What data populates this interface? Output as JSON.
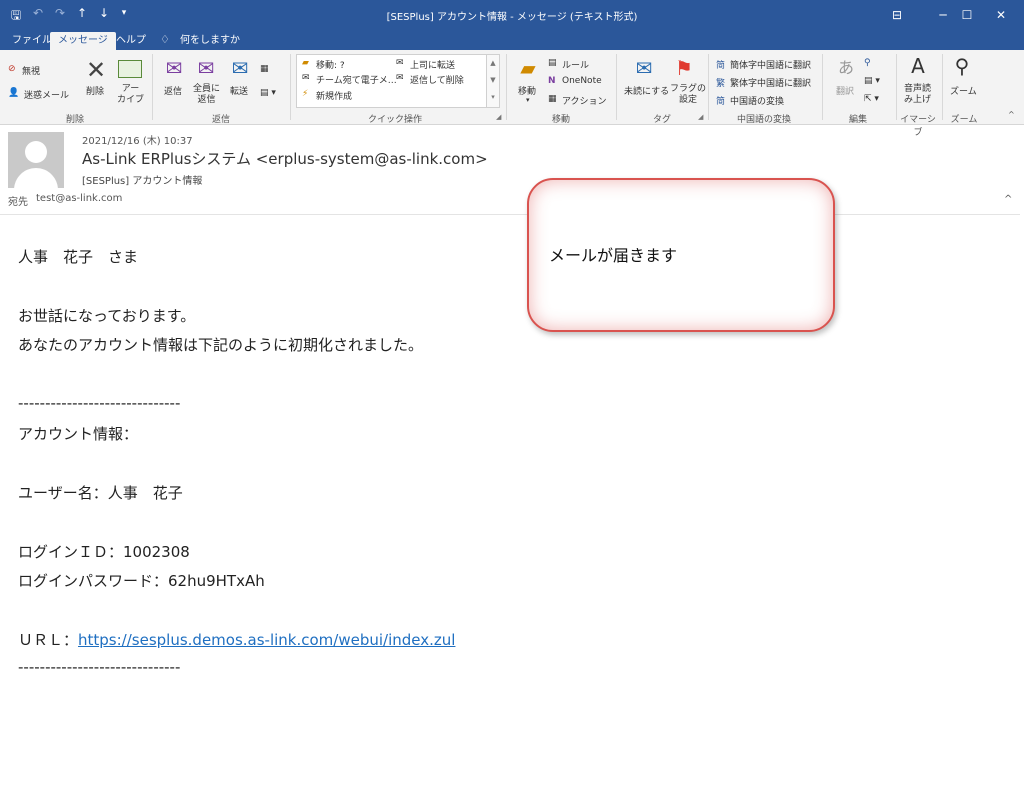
{
  "window": {
    "title": "[SESPlus] アカウント情報 - メッセージ (テキスト形式)",
    "qat": [
      "save-icon",
      "undo-icon",
      "redo-icon",
      "up-arrow-icon",
      "down-arrow-icon",
      "customize-icon"
    ],
    "controls": [
      "ribbon-display-icon",
      "minimize-icon",
      "maximize-icon",
      "close-icon"
    ]
  },
  "tabs": [
    {
      "label": "ファイル"
    },
    {
      "label": "メッセージ"
    },
    {
      "label": "ヘルプ"
    },
    {
      "label": "何をしますか"
    }
  ],
  "ribbon": {
    "delete_group": {
      "label": "削除",
      "ignore": "無視",
      "junk": "迷惑メール",
      "delete": "削除",
      "archive": "アー\nカイブ"
    },
    "reply_group": {
      "label": "返信",
      "reply": "返信",
      "reply_all": "全員に\n返信",
      "forward": "転送"
    },
    "quick_group": {
      "label": "クイック操作",
      "move": "移動: ?",
      "team": "チーム宛て電子メ…",
      "new": "新規作成",
      "manager": "上司に転送",
      "reply_delete": "返信して削除"
    },
    "move_group": {
      "label": "移動",
      "move": "移動",
      "rules": "ルール",
      "onenote": "OneNote",
      "actions": "アクション"
    },
    "tags_group": {
      "label": "タグ",
      "unread": "未読にする",
      "flag": "フラグの\n設定"
    },
    "chinese_group": {
      "label": "中国語の変換",
      "simplified": "簡体字中国語に翻訳",
      "traditional": "繁体字中国語に翻訳",
      "convert": "中国語の変換"
    },
    "edit_group": {
      "label": "編集",
      "translate": "翻訳"
    },
    "immersive_group": {
      "label": "イマーシブ",
      "read_aloud": "音声読\nみ上げ"
    },
    "zoom_group": {
      "label": "ズーム",
      "zoom": "ズーム"
    }
  },
  "header": {
    "datetime": "2021/12/16 (木) 10:37",
    "from": "As-Link ERPlusシステム <erplus-system@as-link.com>",
    "subject": "[SESPlus] アカウント情報",
    "to_label": "宛先",
    "to": "test@as-link.com"
  },
  "body": {
    "greeting": "人事　花子　さま",
    "line1": "お世話になっております。",
    "line2": "あなたのアカウント情報は下記のように初期化されました。",
    "divider": "------------------------------",
    "account_label": "アカウント情報：",
    "user": "ユーザー名：人事　花子",
    "login_id": "ログインＩＤ：1002308",
    "password": "ログインパスワード：62hu9HTxAh",
    "url_label": "ＵＲＬ：",
    "url": "https://sesplus.demos.as-link.com/webui/index.zul"
  },
  "callout": {
    "text": "メールが届きます"
  },
  "colors": {
    "titlebar": "#2b579a",
    "callout_border": "#d9534f",
    "link": "#1f6fc1"
  }
}
